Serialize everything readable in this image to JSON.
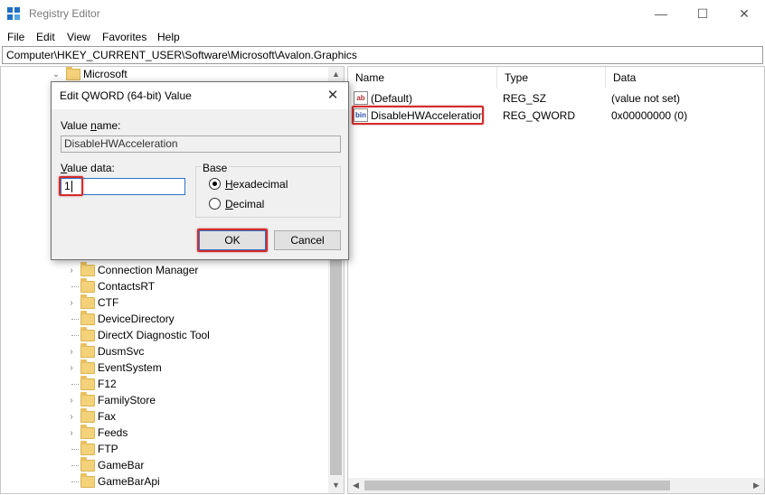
{
  "window": {
    "title": "Registry Editor",
    "controls": {
      "minimize": "—",
      "maximize": "☐",
      "close": "✕"
    }
  },
  "menu": [
    "File",
    "Edit",
    "View",
    "Favorites",
    "Help"
  ],
  "address": "Computer\\HKEY_CURRENT_USER\\Software\\Microsoft\\Avalon.Graphics",
  "tree": {
    "root": {
      "label": "Microsoft",
      "expander": "⌄"
    },
    "items": [
      {
        "label": "Connection Manager",
        "expandable": true
      },
      {
        "label": "ContactsRT",
        "expandable": false
      },
      {
        "label": "CTF",
        "expandable": true
      },
      {
        "label": "DeviceDirectory",
        "expandable": false
      },
      {
        "label": "DirectX Diagnostic Tool",
        "expandable": false
      },
      {
        "label": "DusmSvc",
        "expandable": true
      },
      {
        "label": "EventSystem",
        "expandable": true
      },
      {
        "label": "F12",
        "expandable": false
      },
      {
        "label": "FamilyStore",
        "expandable": true
      },
      {
        "label": "Fax",
        "expandable": true
      },
      {
        "label": "Feeds",
        "expandable": true
      },
      {
        "label": "FTP",
        "expandable": false
      },
      {
        "label": "GameBar",
        "expandable": false
      },
      {
        "label": "GameBarApi",
        "expandable": false
      }
    ],
    "expander_glyph": "›",
    "scroll_up": "▲",
    "scroll_down": "▼"
  },
  "values_panel": {
    "columns": [
      "Name",
      "Type",
      "Data"
    ],
    "rows": [
      {
        "icon": "ab",
        "name": "(Default)",
        "type": "REG_SZ",
        "data": "(value not set)"
      },
      {
        "icon": "bin",
        "name": "DisableHWAcceleration",
        "type": "REG_QWORD",
        "data": "0x00000000 (0)"
      }
    ],
    "scroll_left": "◀",
    "scroll_right": "▶"
  },
  "dialog": {
    "title": "Edit QWORD (64-bit) Value",
    "close": "✕",
    "value_name_label_pre": "Value ",
    "value_name_label_u": "n",
    "value_name_label_post": "ame:",
    "value_name": "DisableHWAcceleration",
    "value_data_label_u": "V",
    "value_data_label_post": "alue data:",
    "value_data": "1",
    "base_label": "Base",
    "hex_label_u": "H",
    "hex_label_post": "exadecimal",
    "dec_label_u": "D",
    "dec_label_post": "ecimal",
    "ok": "OK",
    "cancel": "Cancel"
  },
  "colors": {
    "highlight": "#d52b2b",
    "accent": "#2b74c7"
  }
}
